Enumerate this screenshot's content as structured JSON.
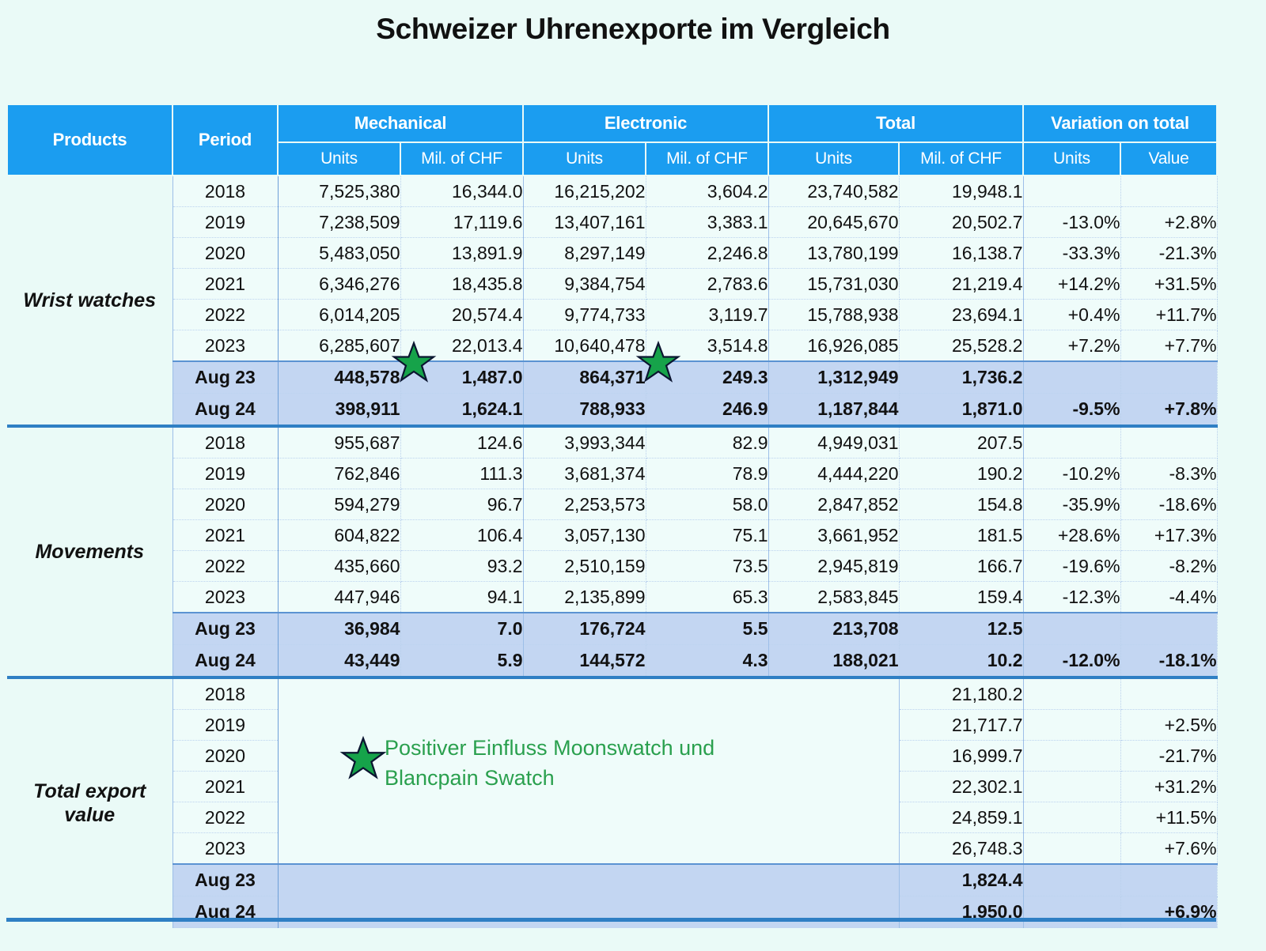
{
  "title": "Schweizer Uhrenexporte im Vergleich",
  "accent_blue": "#1b9df0",
  "highlight_row_bg": "#c3d6f2",
  "page_bg": "#eafaf7",
  "annotation_green": "#2aa04e",
  "header": {
    "products": "Products",
    "period": "Period",
    "groups": [
      {
        "label": "Mechanical",
        "sub": [
          "Units",
          "Mil. of CHF"
        ]
      },
      {
        "label": "Electronic",
        "sub": [
          "Units",
          "Mil. of CHF"
        ]
      },
      {
        "label": "Total",
        "sub": [
          "Units",
          "Mil. of CHF"
        ]
      },
      {
        "label": "Variation on total",
        "sub": [
          "Units",
          "Value"
        ]
      }
    ]
  },
  "annotation": {
    "icon": "green-star-icon",
    "line1": "Positiver Einfluss Moonswatch und",
    "line2": "Blancpain Swatch",
    "text": "Positiver Einfluss Moonswatch und Blancpain Swatch"
  },
  "sections": [
    {
      "product": "Wrist watches",
      "product_line1": "Wrist watches",
      "product_line2": "",
      "rows": [
        {
          "period": "2018",
          "mech_units": "7,525,380",
          "mech_chf": "16,344.0",
          "elec_units": "16,215,202",
          "elec_chf": "3,604.2",
          "tot_units": "23,740,582",
          "tot_chf": "19,948.1",
          "var_units": "",
          "var_value": "",
          "highlight": false
        },
        {
          "period": "2019",
          "mech_units": "7,238,509",
          "mech_chf": "17,119.6",
          "elec_units": "13,407,161",
          "elec_chf": "3,383.1",
          "tot_units": "20,645,670",
          "tot_chf": "20,502.7",
          "var_units": "-13.0%",
          "var_value": "+2.8%",
          "highlight": false
        },
        {
          "period": "2020",
          "mech_units": "5,483,050",
          "mech_chf": "13,891.9",
          "elec_units": "8,297,149",
          "elec_chf": "2,246.8",
          "tot_units": "13,780,199",
          "tot_chf": "16,138.7",
          "var_units": "-33.3%",
          "var_value": "-21.3%",
          "highlight": false
        },
        {
          "period": "2021",
          "mech_units": "6,346,276",
          "mech_chf": "18,435.8",
          "elec_units": "9,384,754",
          "elec_chf": "2,783.6",
          "tot_units": "15,731,030",
          "tot_chf": "21,219.4",
          "var_units": "+14.2%",
          "var_value": "+31.5%",
          "highlight": false
        },
        {
          "period": "2022",
          "mech_units": "6,014,205",
          "mech_chf": "20,574.4",
          "elec_units": "9,774,733",
          "elec_chf": "3,119.7",
          "tot_units": "15,788,938",
          "tot_chf": "23,694.1",
          "var_units": "+0.4%",
          "var_value": "+11.7%",
          "highlight": false
        },
        {
          "period": "2023",
          "mech_units": "6,285,607",
          "mech_chf": "22,013.4",
          "elec_units": "10,640,478",
          "elec_chf": "3,514.8",
          "tot_units": "16,926,085",
          "tot_chf": "25,528.2",
          "var_units": "+7.2%",
          "var_value": "+7.7%",
          "highlight": false
        },
        {
          "period": "Aug 23",
          "mech_units": "448,578",
          "mech_chf": "1,487.0",
          "elec_units": "864,371",
          "elec_chf": "249.3",
          "tot_units": "1,312,949",
          "tot_chf": "1,736.2",
          "var_units": "",
          "var_value": "",
          "highlight": true
        },
        {
          "period": "Aug 24",
          "mech_units": "398,911",
          "mech_chf": "1,624.1",
          "elec_units": "788,933",
          "elec_chf": "246.9",
          "tot_units": "1,187,844",
          "tot_chf": "1,871.0",
          "var_units": "-9.5%",
          "var_value": "+7.8%",
          "highlight": true
        }
      ]
    },
    {
      "product": "Movements",
      "product_line1": "Movements",
      "product_line2": "",
      "rows": [
        {
          "period": "2018",
          "mech_units": "955,687",
          "mech_chf": "124.6",
          "elec_units": "3,993,344",
          "elec_chf": "82.9",
          "tot_units": "4,949,031",
          "tot_chf": "207.5",
          "var_units": "",
          "var_value": "",
          "highlight": false
        },
        {
          "period": "2019",
          "mech_units": "762,846",
          "mech_chf": "111.3",
          "elec_units": "3,681,374",
          "elec_chf": "78.9",
          "tot_units": "4,444,220",
          "tot_chf": "190.2",
          "var_units": "-10.2%",
          "var_value": "-8.3%",
          "highlight": false
        },
        {
          "period": "2020",
          "mech_units": "594,279",
          "mech_chf": "96.7",
          "elec_units": "2,253,573",
          "elec_chf": "58.0",
          "tot_units": "2,847,852",
          "tot_chf": "154.8",
          "var_units": "-35.9%",
          "var_value": "-18.6%",
          "highlight": false
        },
        {
          "period": "2021",
          "mech_units": "604,822",
          "mech_chf": "106.4",
          "elec_units": "3,057,130",
          "elec_chf": "75.1",
          "tot_units": "3,661,952",
          "tot_chf": "181.5",
          "var_units": "+28.6%",
          "var_value": "+17.3%",
          "highlight": false
        },
        {
          "period": "2022",
          "mech_units": "435,660",
          "mech_chf": "93.2",
          "elec_units": "2,510,159",
          "elec_chf": "73.5",
          "tot_units": "2,945,819",
          "tot_chf": "166.7",
          "var_units": "-19.6%",
          "var_value": "-8.2%",
          "highlight": false
        },
        {
          "period": "2023",
          "mech_units": "447,946",
          "mech_chf": "94.1",
          "elec_units": "2,135,899",
          "elec_chf": "65.3",
          "tot_units": "2,583,845",
          "tot_chf": "159.4",
          "var_units": "-12.3%",
          "var_value": "-4.4%",
          "highlight": false
        },
        {
          "period": "Aug 23",
          "mech_units": "36,984",
          "mech_chf": "7.0",
          "elec_units": "176,724",
          "elec_chf": "5.5",
          "tot_units": "213,708",
          "tot_chf": "12.5",
          "var_units": "",
          "var_value": "",
          "highlight": true
        },
        {
          "period": "Aug 24",
          "mech_units": "43,449",
          "mech_chf": "5.9",
          "elec_units": "144,572",
          "elec_chf": "4.3",
          "tot_units": "188,021",
          "tot_chf": "10.2",
          "var_units": "-12.0%",
          "var_value": "-18.1%",
          "highlight": true
        }
      ]
    },
    {
      "product": "Total export value",
      "product_line1": "Total export",
      "product_line2": "value",
      "merged_blank": true,
      "rows": [
        {
          "period": "2018",
          "tot_chf": "21,180.2",
          "var_units": "",
          "var_value": "",
          "highlight": false
        },
        {
          "period": "2019",
          "tot_chf": "21,717.7",
          "var_units": "",
          "var_value": "+2.5%",
          "highlight": false
        },
        {
          "period": "2020",
          "tot_chf": "16,999.7",
          "var_units": "",
          "var_value": "-21.7%",
          "highlight": false
        },
        {
          "period": "2021",
          "tot_chf": "22,302.1",
          "var_units": "",
          "var_value": "+31.2%",
          "highlight": false
        },
        {
          "period": "2022",
          "tot_chf": "24,859.1",
          "var_units": "",
          "var_value": "+11.5%",
          "highlight": false
        },
        {
          "period": "2023",
          "tot_chf": "26,748.3",
          "var_units": "",
          "var_value": "+7.6%",
          "highlight": false
        },
        {
          "period": "Aug 23",
          "tot_chf": "1,824.4",
          "var_units": "",
          "var_value": "",
          "highlight": true
        },
        {
          "period": "Aug 24",
          "tot_chf": "1,950.0",
          "var_units": "",
          "var_value": "+6.9%",
          "highlight": true
        }
      ]
    }
  ],
  "markers": [
    {
      "name": "star-mechanical-2023",
      "icon": "green-star-icon"
    },
    {
      "name": "star-electronic-2023",
      "icon": "green-star-icon"
    }
  ]
}
